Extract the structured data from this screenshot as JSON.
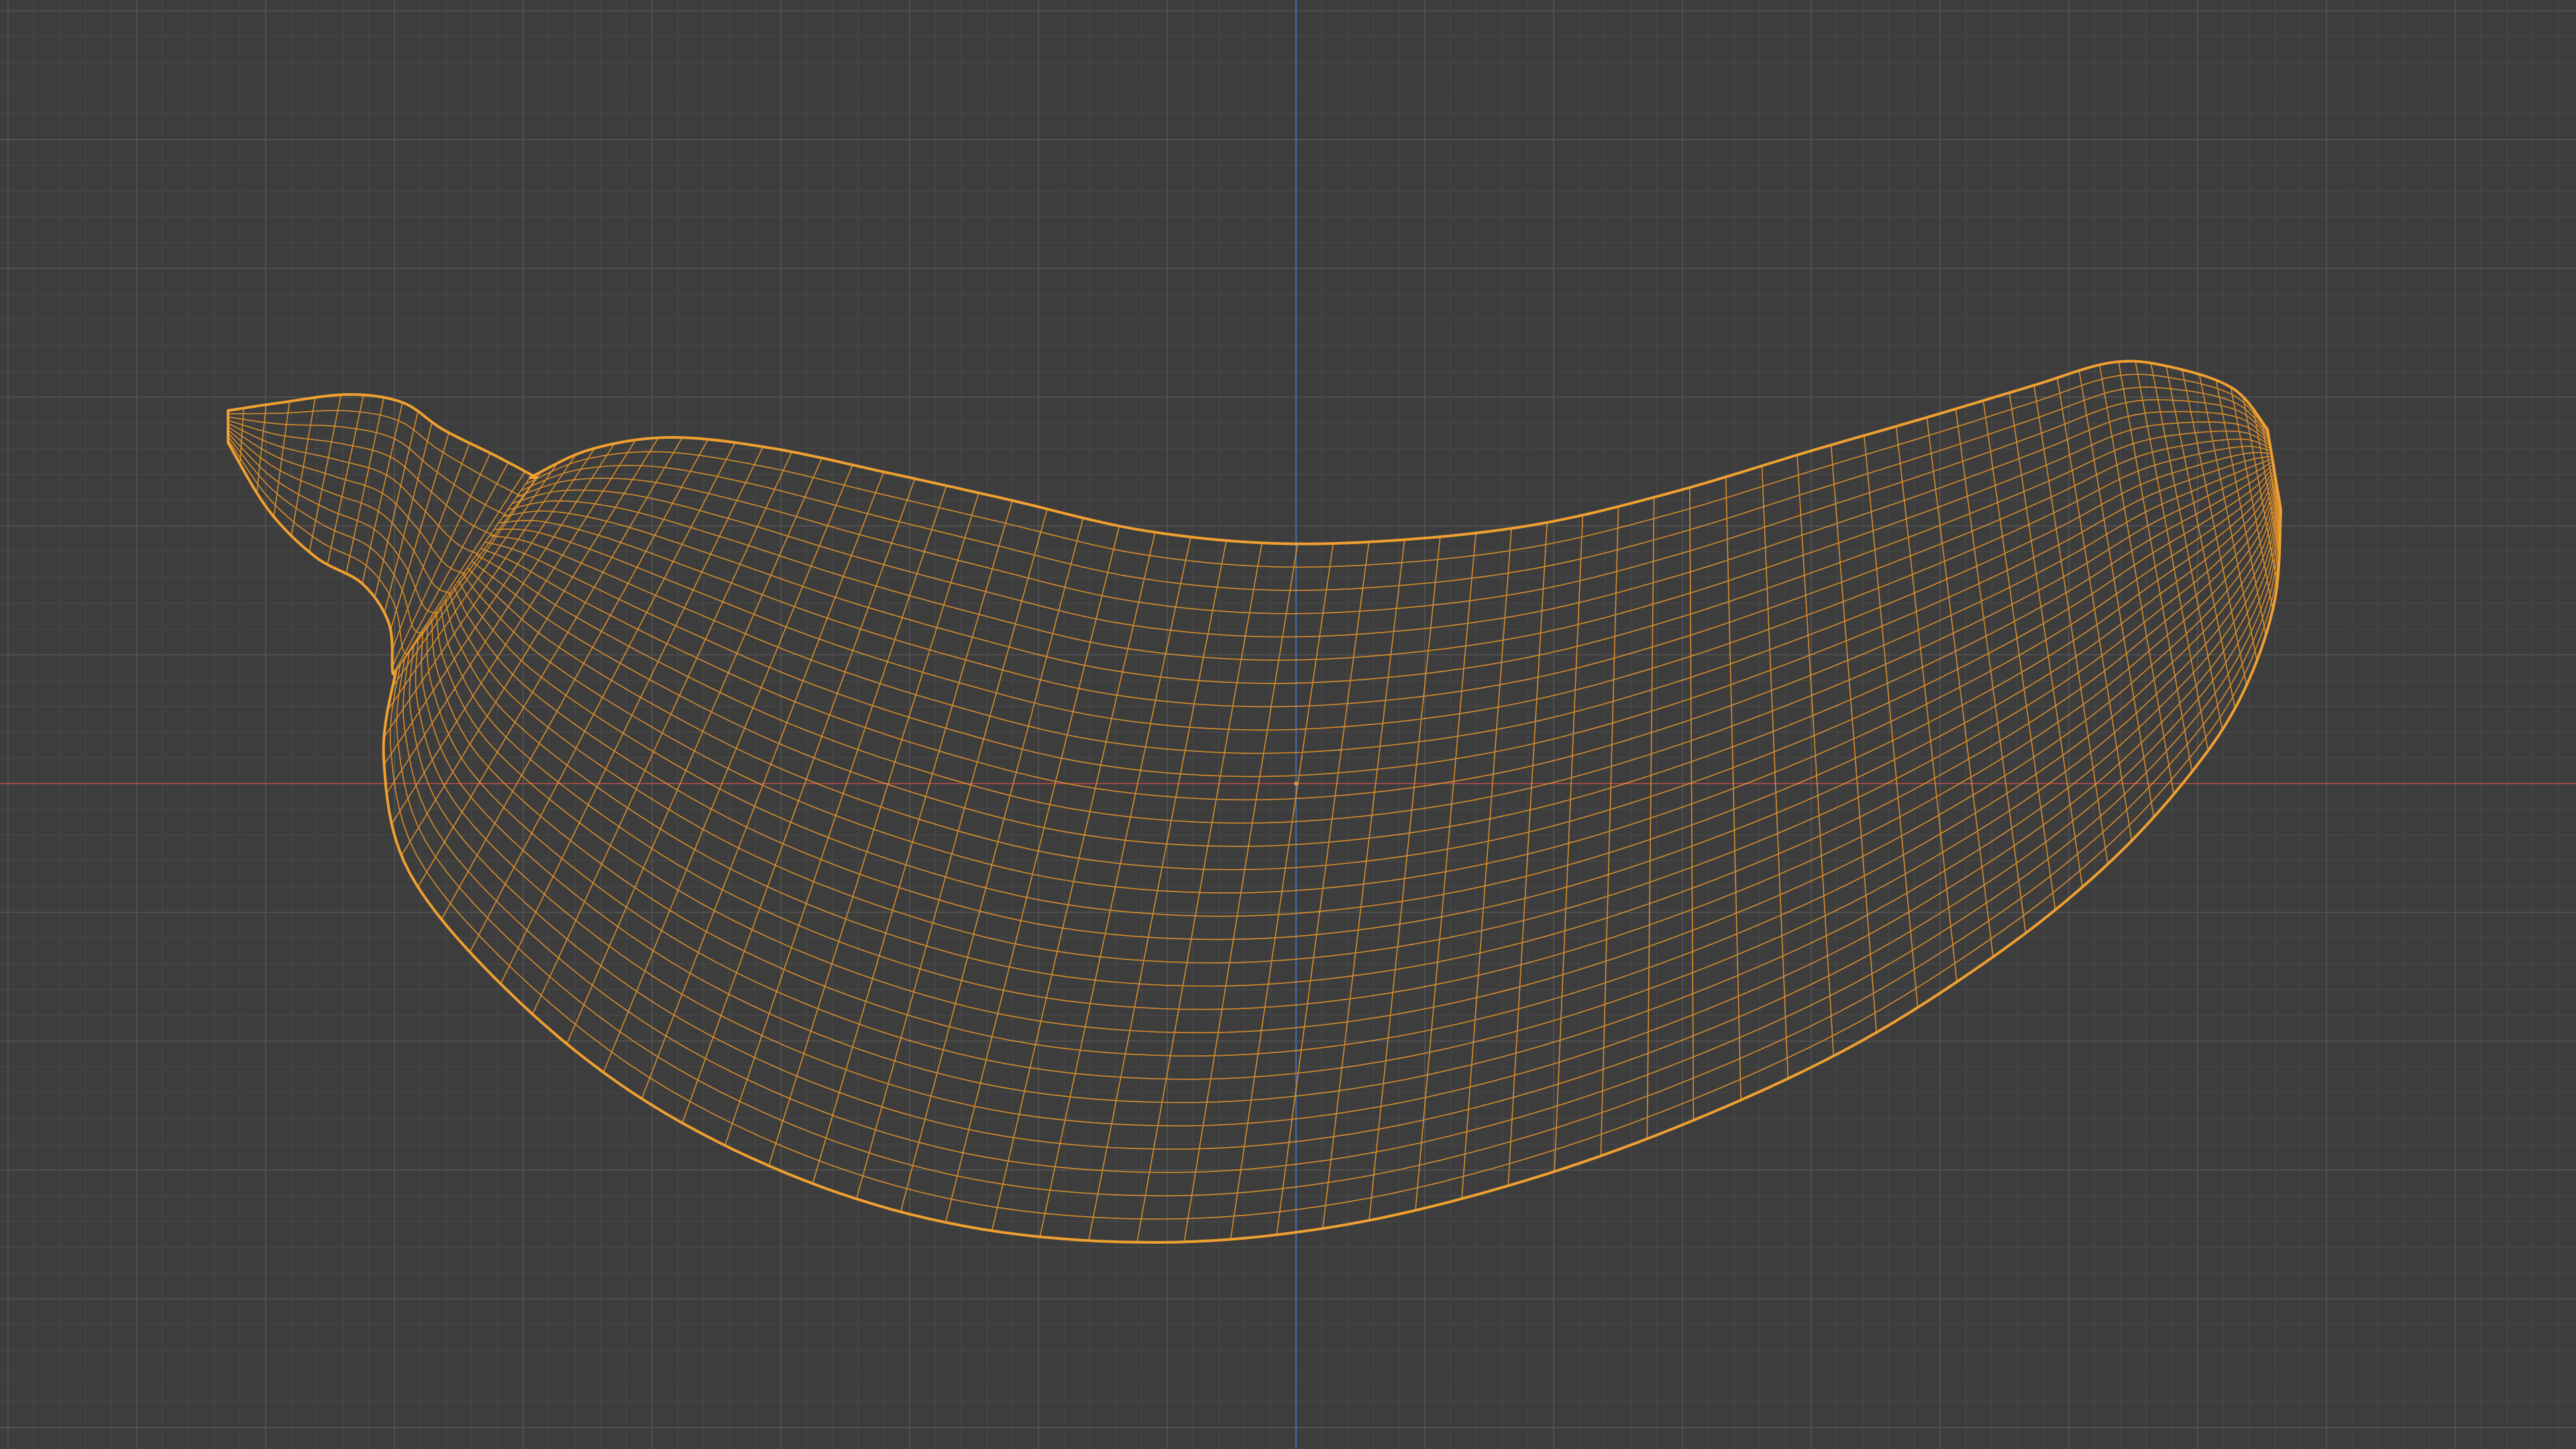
{
  "viewport": {
    "view": "wireframe",
    "selected_object": "banana-mesh"
  },
  "colors": {
    "background": "#3d3d3d",
    "grid_minor": "#464646",
    "grid_major": "#4f4f4f",
    "axis_x": "#9a4a4a",
    "axis_z": "#4a6aa8",
    "wire_selected": "#e8962a",
    "wire_outline": "#f0a030",
    "origin": "#e8962a"
  },
  "icons": {
    "origin": "object-origin-icon"
  }
}
